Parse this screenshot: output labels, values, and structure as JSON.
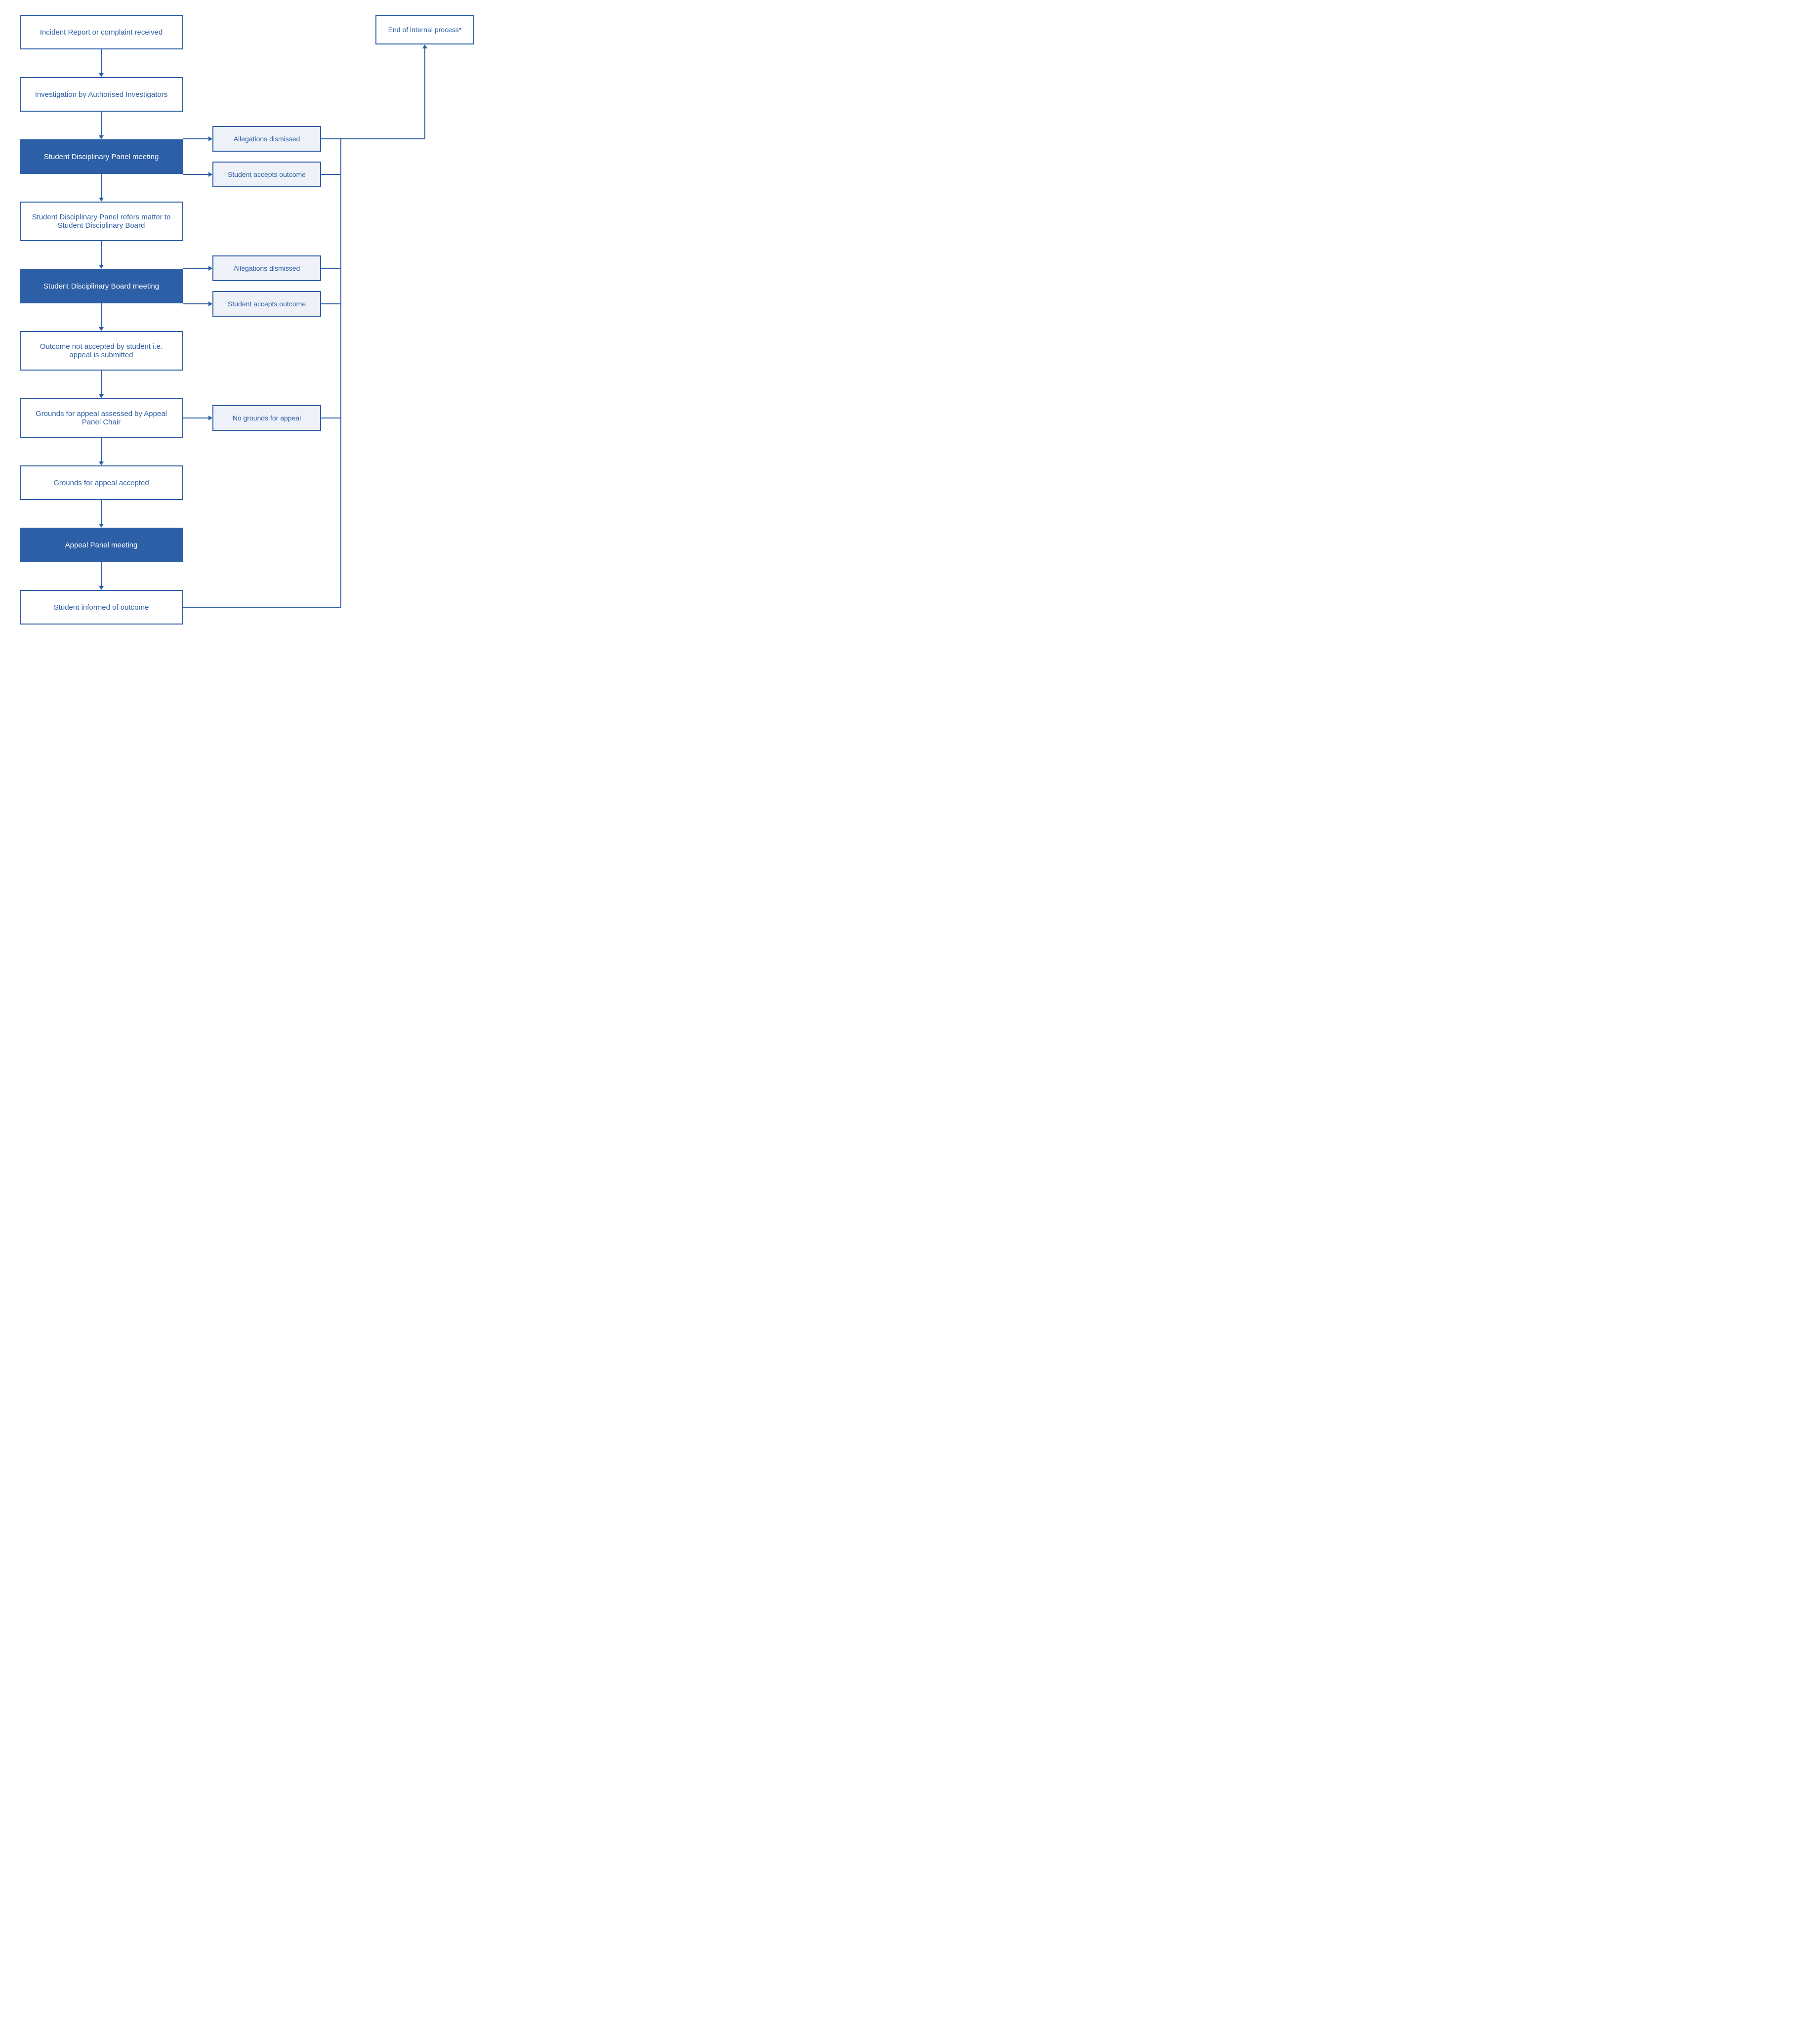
{
  "boxes": {
    "incident": "Incident Report or complaint received",
    "investigation": "Investigation by Authorised Investigators",
    "panel_meeting": "Student Disciplinary Panel meeting",
    "panel_refers": "Student Disciplinary Panel refers matter to Student Disciplinary Board",
    "board_meeting": "Student Disciplinary Board meeting",
    "outcome_not_accepted": "Outcome not accepted by student i.e. appeal is submitted",
    "grounds_assessed": "Grounds for appeal assessed by Appeal Panel Chair",
    "grounds_accepted": "Grounds for appeal accepted",
    "appeal_panel": "Appeal Panel meeting",
    "student_informed": "Student informed of outcome",
    "end_internal": "End of internal process*",
    "allegations_dismissed_1": "Allegations dismissed",
    "student_accepts_1": "Student accepts outcome",
    "allegations_dismissed_2": "Allegations dismissed",
    "student_accepts_2": "Student accepts outcome",
    "no_grounds": "No grounds for appeal"
  },
  "colors": {
    "blue": "#2d5fa6",
    "light_bg": "#eef1f8",
    "white": "#ffffff",
    "dark_blue": "#2d5fa6"
  }
}
